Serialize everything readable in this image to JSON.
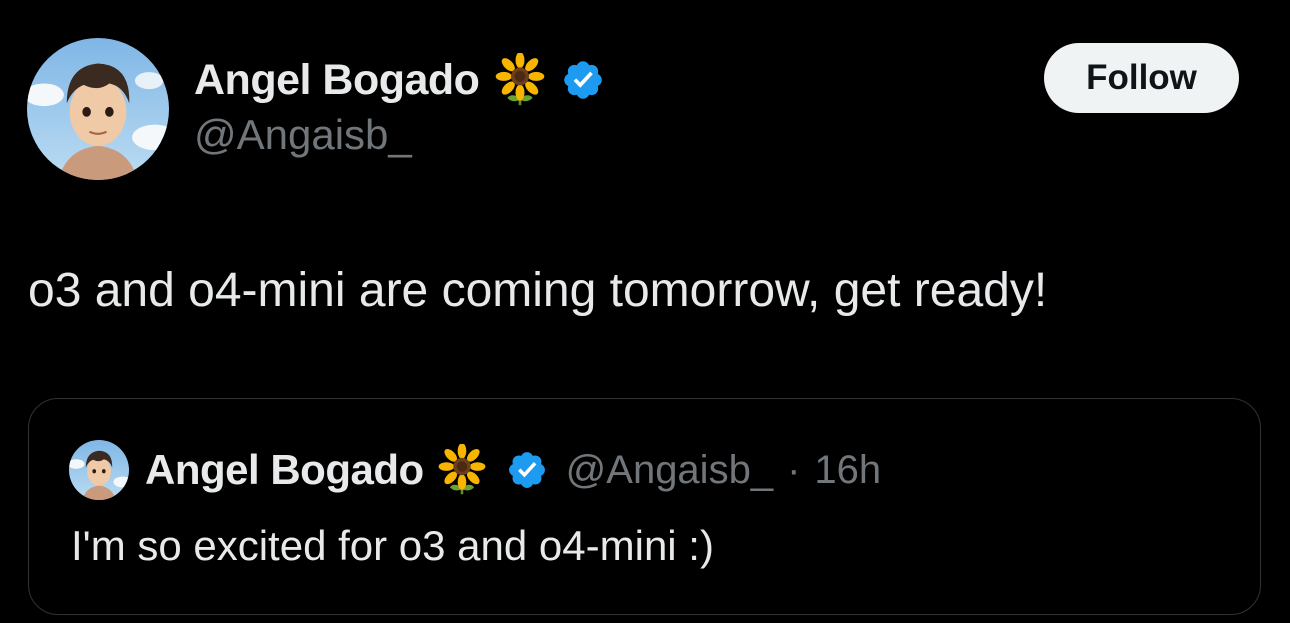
{
  "author": {
    "name": "Angel Bogado",
    "handle": "@Angaisb_",
    "emoji": "sunflower-emoji",
    "badge": "verified-badge-icon"
  },
  "follow_button": {
    "label": "Follow"
  },
  "tweet": {
    "text": "o3 and o4-mini are coming tomorrow, get ready!"
  },
  "quoted_tweet": {
    "name": "Angel Bogado",
    "handle": "@Angaisb_",
    "separator": "·",
    "time": "16h",
    "text": "I'm so excited for o3 and o4-mini :)"
  },
  "colors": {
    "background": "#000000",
    "primary_text": "#e7e9ea",
    "secondary_text": "#71767b",
    "verified_blue": "#1d9bf0",
    "follow_bg": "#eff3f4",
    "border": "#2f3336"
  }
}
